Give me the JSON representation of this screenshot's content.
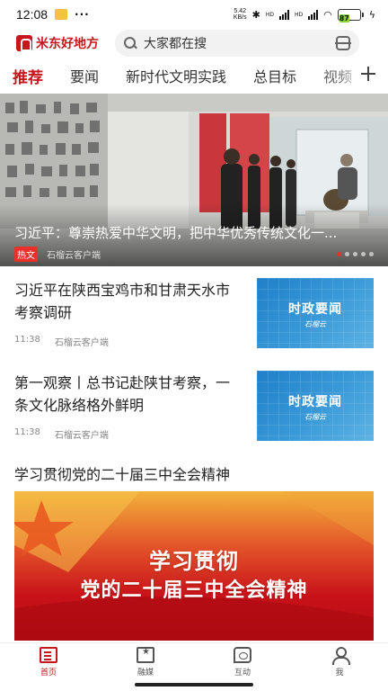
{
  "status_bar": {
    "time": "12:08",
    "more": "···",
    "net_speed_value": "5.42",
    "net_speed_unit": "KB/s",
    "net_type_1": "HD",
    "net_type_2": "HD",
    "battery": "87"
  },
  "header": {
    "app_name": "米东好地方",
    "search_placeholder": "大家都在搜"
  },
  "tabs": [
    "推荐",
    "要闻",
    "新时代文明实践",
    "总目标",
    "视频"
  ],
  "active_tab": "推荐",
  "hero": {
    "title": "习近平：尊崇热爱中华文明，把中华优秀传统文化一...",
    "badge": "热文",
    "source": "石榴云客户端",
    "slide_count": 5,
    "active_slide": 1
  },
  "news": [
    {
      "title": "习近平在陕西宝鸡市和甘肃天水市考察调研",
      "time": "11:38",
      "source": "石榴云客户端",
      "thumb_title": "时政要闻",
      "thumb_sub": "石榴云"
    },
    {
      "title": "第一观察丨总书记赴陕甘考察，一条文化脉络格外鲜明",
      "time": "11:38",
      "source": "石榴云客户端",
      "thumb_title": "时政要闻",
      "thumb_sub": "石榴云"
    }
  ],
  "section": {
    "title": "学习贯彻党的二十届三中全会精神",
    "banner_line1": "学习贯彻",
    "banner_line2": "党的二十届三中全会精神"
  },
  "bottom_nav": [
    {
      "label": "首页",
      "icon": "home-icon",
      "active": true
    },
    {
      "label": "融媒",
      "icon": "media-icon",
      "active": false
    },
    {
      "label": "互动",
      "icon": "interact-icon",
      "active": false
    },
    {
      "label": "我",
      "icon": "user-icon",
      "active": false
    }
  ],
  "colors": {
    "brand_red": "#c8161d",
    "hot_badge": "#e9302a",
    "thumb_blue": "#2a8ad0"
  }
}
